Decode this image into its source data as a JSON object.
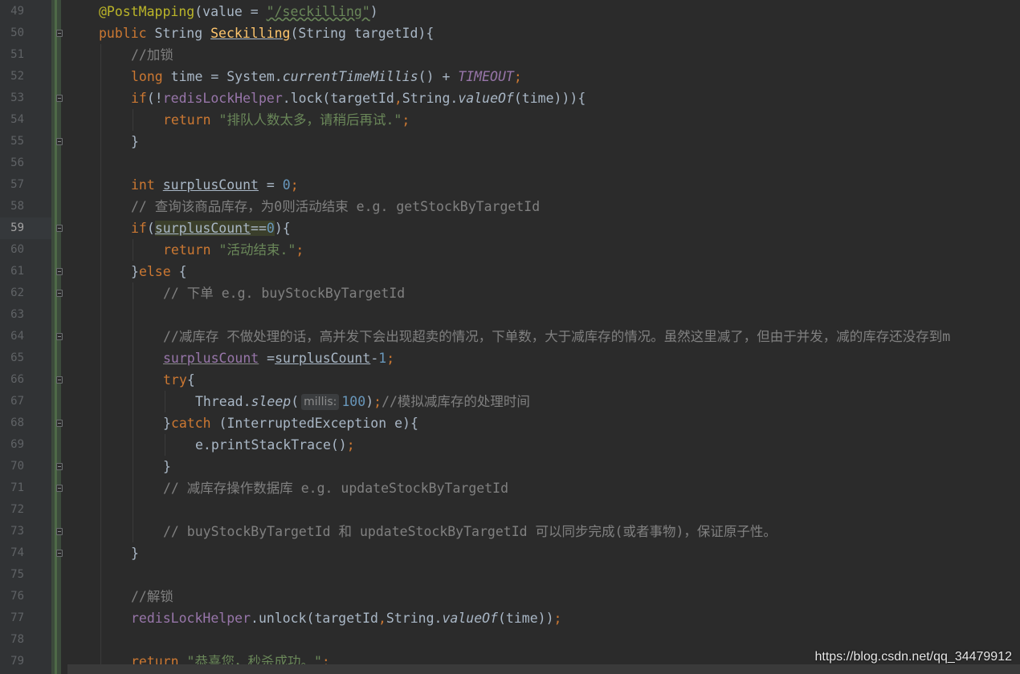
{
  "editor": {
    "lines": [
      {
        "no": "49",
        "fold": false,
        "indent": 1,
        "tokens": [
          [
            "ann",
            "@PostMapping"
          ],
          [
            "p",
            "("
          ],
          [
            "p",
            "value = "
          ],
          [
            "strw",
            "\"/seckilling\""
          ],
          [
            "p",
            ")"
          ]
        ]
      },
      {
        "no": "50",
        "fold": true,
        "indent": 1,
        "tokens": [
          [
            "kw",
            "public "
          ],
          [
            "p",
            "String "
          ],
          [
            "fnu",
            "Seckilling"
          ],
          [
            "p",
            "(String targetId){"
          ]
        ]
      },
      {
        "no": "51",
        "fold": false,
        "indent": 2,
        "tokens": [
          [
            "cm",
            "//加锁"
          ]
        ]
      },
      {
        "no": "52",
        "fold": false,
        "indent": 2,
        "tokens": [
          [
            "kw",
            "long "
          ],
          [
            "p",
            "time = System."
          ],
          [
            "it",
            "currentTimeMillis"
          ],
          [
            "p",
            "() + "
          ],
          [
            "fldit",
            "TIMEOUT"
          ],
          [
            "kw",
            ";"
          ]
        ]
      },
      {
        "no": "53",
        "fold": true,
        "indent": 2,
        "tokens": [
          [
            "kw",
            "if"
          ],
          [
            "p",
            "(!"
          ],
          [
            "fld",
            "redisLockHelper"
          ],
          [
            "p",
            ".lock(targetId"
          ],
          [
            "kw",
            ","
          ],
          [
            "p",
            "String."
          ],
          [
            "it",
            "valueOf"
          ],
          [
            "p",
            "(time))){"
          ]
        ]
      },
      {
        "no": "54",
        "fold": false,
        "indent": 3,
        "tokens": [
          [
            "kw",
            "return "
          ],
          [
            "str",
            "\"排队人数太多，请稍后再试.\""
          ],
          [
            "kw",
            ";"
          ]
        ]
      },
      {
        "no": "55",
        "fold": true,
        "indent": 2,
        "tokens": [
          [
            "p",
            "}"
          ]
        ]
      },
      {
        "no": "56",
        "fold": false,
        "indent": 2,
        "tokens": []
      },
      {
        "no": "57",
        "fold": false,
        "indent": 2,
        "tokens": [
          [
            "kw",
            "int "
          ],
          [
            "und",
            "surplusCount"
          ],
          [
            "p",
            " = "
          ],
          [
            "num",
            "0"
          ],
          [
            "kw",
            ";"
          ]
        ]
      },
      {
        "no": "58",
        "fold": false,
        "indent": 2,
        "tokens": [
          [
            "cm",
            "// 查询该商品库存，为0则活动结束 e.g. getStockByTargetId"
          ]
        ]
      },
      {
        "no": "59",
        "fold": true,
        "indent": 2,
        "current": true,
        "tokens": [
          [
            "kw",
            "if"
          ],
          [
            "p",
            "("
          ],
          [
            "hlund",
            "surplusCount"
          ],
          [
            "hl",
            "=="
          ],
          [
            "hlnum",
            "0"
          ],
          [
            "p",
            "){"
          ]
        ]
      },
      {
        "no": "60",
        "fold": false,
        "indent": 3,
        "tokens": [
          [
            "kw",
            "return "
          ],
          [
            "str",
            "\"活动结束.\""
          ],
          [
            "kw",
            ";"
          ]
        ]
      },
      {
        "no": "61",
        "fold": true,
        "indent": 2,
        "tokens": [
          [
            "p",
            "}"
          ],
          [
            "kw",
            "else "
          ],
          [
            "p",
            "{"
          ]
        ]
      },
      {
        "no": "62",
        "fold": true,
        "indent": 3,
        "tokens": [
          [
            "cm",
            "// 下单 e.g. buyStockByTargetId"
          ]
        ]
      },
      {
        "no": "63",
        "fold": false,
        "indent": 3,
        "tokens": []
      },
      {
        "no": "64",
        "fold": true,
        "indent": 3,
        "tokens": [
          [
            "cm",
            "//减库存 不做处理的话，高并发下会出现超卖的情况，下单数，大于减库存的情况。虽然这里减了，但由于并发，减的库存还没存到m"
          ]
        ]
      },
      {
        "no": "65",
        "fold": false,
        "indent": 3,
        "tokens": [
          [
            "undd",
            "surplusCount"
          ],
          [
            "p",
            " ="
          ],
          [
            "und",
            "surplusCount"
          ],
          [
            "p",
            "-"
          ],
          [
            "num",
            "1"
          ],
          [
            "kw",
            ";"
          ]
        ]
      },
      {
        "no": "66",
        "fold": true,
        "indent": 3,
        "tokens": [
          [
            "kw",
            "try"
          ],
          [
            "p",
            "{"
          ]
        ]
      },
      {
        "no": "67",
        "fold": false,
        "indent": 4,
        "tokens": [
          [
            "p",
            "Thread."
          ],
          [
            "it",
            "sleep"
          ],
          [
            "p",
            "("
          ],
          [
            "hint",
            "millis:"
          ],
          [
            "num",
            "100"
          ],
          [
            "p",
            ")"
          ],
          [
            "kw",
            ";"
          ],
          [
            "cm",
            "//模拟减库存的处理时间"
          ]
        ]
      },
      {
        "no": "68",
        "fold": true,
        "indent": 3,
        "tokens": [
          [
            "p",
            "}"
          ],
          [
            "kw",
            "catch "
          ],
          [
            "p",
            "(InterruptedException e){"
          ]
        ]
      },
      {
        "no": "69",
        "fold": false,
        "indent": 4,
        "tokens": [
          [
            "p",
            "e.printStackTrace()"
          ],
          [
            "kw",
            ";"
          ]
        ]
      },
      {
        "no": "70",
        "fold": true,
        "indent": 3,
        "tokens": [
          [
            "p",
            "}"
          ]
        ]
      },
      {
        "no": "71",
        "fold": true,
        "indent": 3,
        "tokens": [
          [
            "cm",
            "// 减库存操作数据库 e.g. updateStockByTargetId"
          ]
        ]
      },
      {
        "no": "72",
        "fold": false,
        "indent": 3,
        "tokens": []
      },
      {
        "no": "73",
        "fold": true,
        "indent": 3,
        "tokens": [
          [
            "cm",
            "// buyStockByTargetId 和 updateStockByTargetId 可以同步完成(或者事物)，保证原子性。"
          ]
        ]
      },
      {
        "no": "74",
        "fold": true,
        "indent": 2,
        "tokens": [
          [
            "p",
            "}"
          ]
        ]
      },
      {
        "no": "75",
        "fold": false,
        "indent": 2,
        "tokens": []
      },
      {
        "no": "76",
        "fold": false,
        "indent": 2,
        "tokens": [
          [
            "cm",
            "//解锁"
          ]
        ]
      },
      {
        "no": "77",
        "fold": false,
        "indent": 2,
        "tokens": [
          [
            "fld",
            "redisLockHelper"
          ],
          [
            "p",
            ".unlock(targetId"
          ],
          [
            "kw",
            ","
          ],
          [
            "p",
            "String."
          ],
          [
            "it",
            "valueOf"
          ],
          [
            "p",
            "(time))"
          ],
          [
            "kw",
            ";"
          ]
        ]
      },
      {
        "no": "78",
        "fold": false,
        "indent": 2,
        "tokens": []
      },
      {
        "no": "79",
        "fold": false,
        "indent": 2,
        "tokens": [
          [
            "kw",
            "return "
          ],
          [
            "str",
            "\"恭喜您，秒杀成功。\""
          ],
          [
            "kw",
            ";"
          ]
        ]
      }
    ]
  },
  "watermark": "https://blog.csdn.net/qq_34479912",
  "colors": {
    "background": "#2b2b2b",
    "keyword": "#cc7832",
    "string": "#6a8759",
    "number": "#6897bb",
    "comment": "#808080",
    "annotation": "#bbb529",
    "method": "#ffc66d",
    "field": "#9876aa"
  }
}
